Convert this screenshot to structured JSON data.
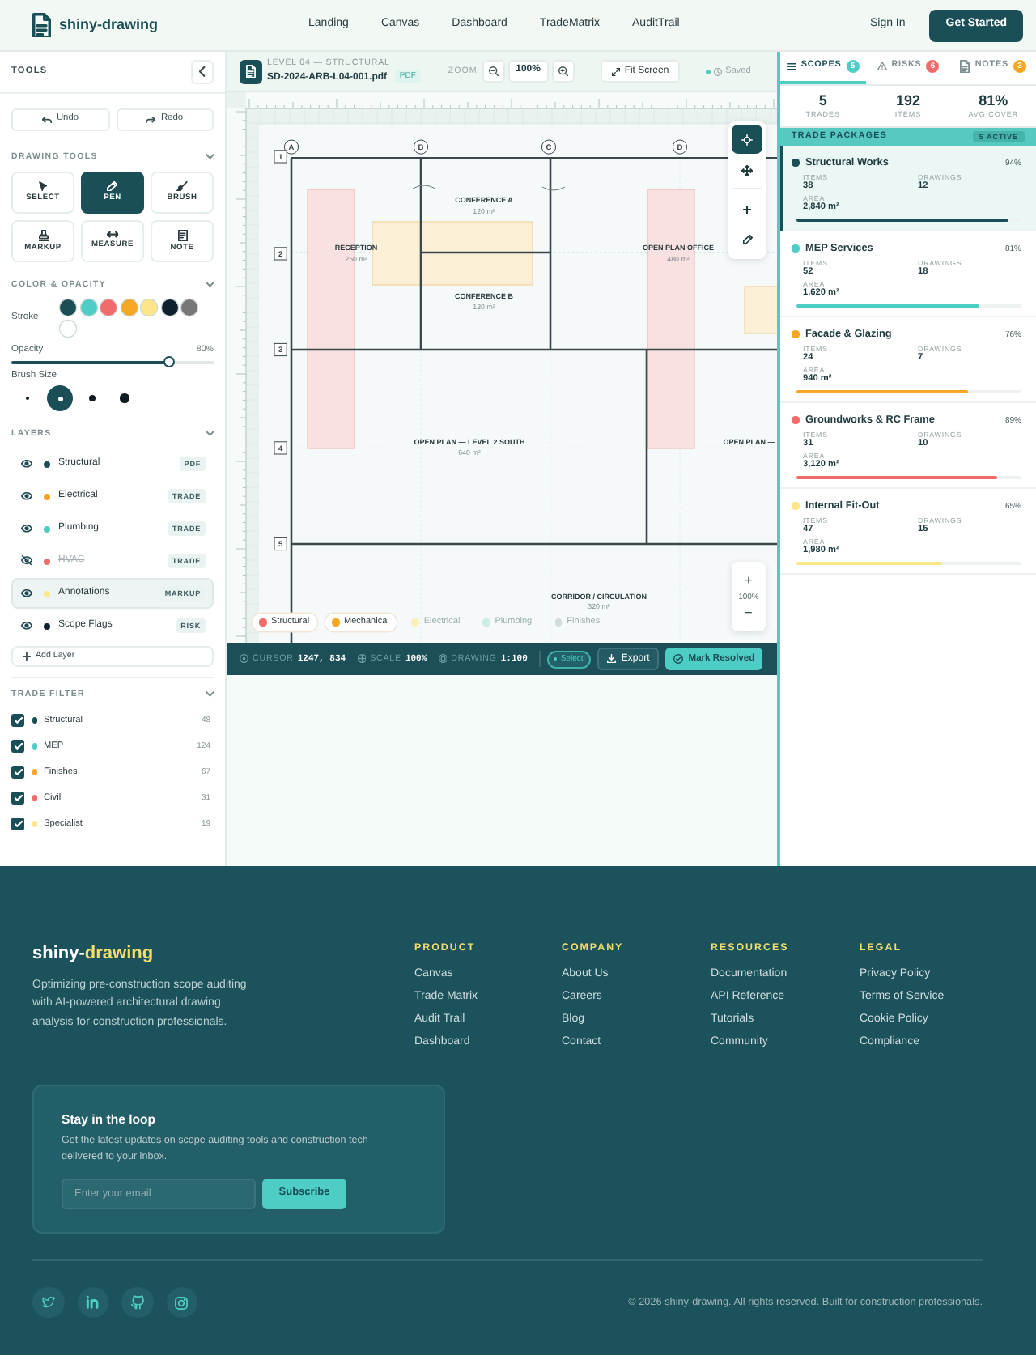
{
  "navbar": {
    "brand": "shiny-drawing",
    "links": [
      "Landing",
      "Canvas",
      "Dashboard",
      "TradeMatrix",
      "AuditTrail"
    ],
    "sign_in": "Sign In",
    "cta": "Get Started"
  },
  "sidebar": {
    "title": "TOOLS",
    "history": [
      {
        "kind": "undo",
        "label": "Undo"
      },
      {
        "kind": "redo",
        "label": "Redo"
      }
    ],
    "drawing_tools": {
      "title": "DRAWING TOOLS",
      "expanded": true,
      "tools": [
        {
          "kind": "select",
          "label": "SELECT",
          "selected": false
        },
        {
          "kind": "pen",
          "label": "PEN",
          "selected": true
        },
        {
          "kind": "brush",
          "label": "BRUSH",
          "selected": false
        },
        {
          "kind": "markup",
          "label": "MARKUP",
          "selected": false
        },
        {
          "kind": "measure",
          "label": "MEASURE",
          "selected": false
        },
        {
          "kind": "note",
          "label": "NOTE",
          "selected": false
        }
      ]
    },
    "color_opacity": {
      "title": "COLOR & OPACITY",
      "expanded": true,
      "stroke_label": "Stroke",
      "swatches": [
        {
          "color": "#1b4f57"
        },
        {
          "color": "#4ecdc4"
        },
        {
          "color": "#f26b6b"
        },
        {
          "color": "#f5a623"
        },
        {
          "color": "#fde68a"
        },
        {
          "color": "#0f1f2e"
        },
        {
          "color": "#777777"
        },
        {
          "color": "#ffffff"
        }
      ],
      "opacity": {
        "label": "Opacity",
        "reading": "80%",
        "level": 0.8
      },
      "brush_size": {
        "label": "Brush Size",
        "sizes": [
          {
            "kind": "xs",
            "selected": false
          },
          {
            "kind": "sm",
            "selected": true
          },
          {
            "kind": "md",
            "selected": false
          },
          {
            "kind": "lg",
            "selected": false
          }
        ]
      }
    },
    "layers": {
      "title": "LAYERS",
      "expanded": true,
      "items": [
        {
          "name": "Structural",
          "color": "#1b4f57",
          "visible": true,
          "selected": false,
          "tag": "PDF"
        },
        {
          "name": "Electrical",
          "color": "#f5a623",
          "visible": true,
          "selected": false,
          "tag": "TRADE"
        },
        {
          "name": "Plumbing",
          "color": "#4ecdc4",
          "visible": true,
          "selected": false,
          "tag": "TRADE"
        },
        {
          "name": "HVAC",
          "color": "#f26b6b",
          "visible": false,
          "selected": false,
          "tag": "TRADE"
        },
        {
          "name": "Annotations",
          "color": "#fde68a",
          "visible": true,
          "selected": true,
          "tag": "MARKUP"
        },
        {
          "name": "Scope Flags",
          "color": "#0f1f2e",
          "visible": true,
          "selected": false,
          "tag": "RISK"
        }
      ],
      "add_label": "Add Layer"
    },
    "trade_filter": {
      "title": "TRADE FILTER",
      "expanded": true,
      "items": [
        {
          "label": "Structural",
          "color": "#1b4f57",
          "checked": true,
          "count": "48"
        },
        {
          "label": "MEP",
          "color": "#4ecdc4",
          "checked": true,
          "count": "124"
        },
        {
          "label": "Finishes",
          "color": "#f5a623",
          "checked": true,
          "count": "67"
        },
        {
          "label": "Civil",
          "color": "#f26b6b",
          "checked": true,
          "count": "31"
        },
        {
          "label": "Specialist",
          "color": "#fde68a",
          "checked": true,
          "count": "19"
        }
      ]
    }
  },
  "canvas": {
    "sheet": {
      "subtitle": "LEVEL 04 — STRUCTURAL",
      "file": "SD-2024-ARB-L04-001.pdf",
      "format": "PDF"
    },
    "zoom": {
      "label": "ZOOM",
      "value": "100%"
    },
    "fit_label": "Fit Screen",
    "save_status": "Saved",
    "plan": {
      "columns": [
        "A",
        "B",
        "C",
        "D"
      ],
      "rows": [
        "1",
        "2",
        "3",
        "4",
        "5"
      ],
      "rooms": [
        {
          "name": "CONFERENCE A",
          "area": "120 m²"
        },
        {
          "name": "RECEPTION",
          "area": "250 m²"
        },
        {
          "name": "CONFERENCE B",
          "area": "120 m²"
        },
        {
          "name": "OPEN PLAN OFFICE",
          "area": "480 m²"
        },
        {
          "name": "OPEN PLAN — LEVEL 2 SOUTH",
          "area": "640 m²"
        },
        {
          "name": "OPEN PLAN —"
        },
        {
          "name": "CORRIDOR / CIRCULATION",
          "area": "320 m²"
        }
      ],
      "overlays": [
        {
          "kind": "structural"
        },
        {
          "kind": "structural"
        },
        {
          "kind": "mechanical"
        },
        {
          "kind": "mechanical"
        }
      ]
    },
    "palette_groups": [
      [
        {
          "kind": "crosshair",
          "selected": true
        },
        {
          "kind": "move",
          "selected": false
        }
      ],
      [
        {
          "kind": "target",
          "selected": false
        },
        {
          "kind": "pencil",
          "selected": false
        }
      ]
    ],
    "zoom_control": {
      "plus": "+",
      "reading": "100%",
      "minus": "−"
    },
    "legend": [
      {
        "label": "Structural",
        "color": "#f26b6b",
        "on": true
      },
      {
        "label": "Mechanical",
        "color": "#f5a623",
        "on": true
      },
      {
        "label": "Electrical",
        "color": "#fbefb8",
        "on": false
      },
      {
        "label": "Plumbing",
        "color": "#cdebe7",
        "on": false
      },
      {
        "label": "Finishes",
        "color": "#d3dcdc",
        "on": false
      }
    ],
    "status_bar": {
      "items": [
        {
          "kind": "cursor",
          "label": "CURSOR",
          "value": "1247, 834"
        },
        {
          "kind": "scale",
          "label": "SCALE",
          "value": "100%"
        },
        {
          "kind": "drawing",
          "label": "DRAWING",
          "value": "1:100"
        }
      ],
      "chip": "Selecti",
      "export": "Export",
      "resolve": "Mark Resolved"
    }
  },
  "panel": {
    "tabs": [
      {
        "kind": "list",
        "label": "SCOPES",
        "count": "5",
        "color": "#4ecdc4",
        "selected": true
      },
      {
        "kind": "warning",
        "label": "RISKS",
        "count": "6",
        "color": "#f26b6b",
        "selected": false
      },
      {
        "kind": "document",
        "label": "NOTES",
        "count": "3",
        "color": "#f5a623",
        "selected": false
      }
    ],
    "stats": [
      {
        "value": "5",
        "label": "TRADES"
      },
      {
        "value": "192",
        "label": "ITEMS"
      },
      {
        "value": "81%",
        "label": "AVG COVER"
      }
    ],
    "packages": {
      "title": "TRADE PACKAGES",
      "badge": "5 ACTIVE",
      "items": [
        {
          "name": "Structural Works",
          "color": "#1b4f57",
          "percent": "94%",
          "level": 0.94,
          "selected": true,
          "fields": [
            {
              "label": "ITEMS",
              "value": "38"
            },
            {
              "label": "DRAWINGS",
              "value": "12"
            },
            {
              "label": "AREA",
              "value": "2,840 m²"
            }
          ]
        },
        {
          "name": "MEP Services",
          "color": "#4ecdc4",
          "percent": "81%",
          "level": 0.81,
          "selected": false,
          "fields": [
            {
              "label": "ITEMS",
              "value": "52"
            },
            {
              "label": "DRAWINGS",
              "value": "18"
            },
            {
              "label": "AREA",
              "value": "1,620 m²"
            }
          ]
        },
        {
          "name": "Facade & Glazing",
          "color": "#f5a623",
          "percent": "76%",
          "level": 0.76,
          "selected": false,
          "fields": [
            {
              "label": "ITEMS",
              "value": "24"
            },
            {
              "label": "DRAWINGS",
              "value": "7"
            },
            {
              "label": "AREA",
              "value": "940 m²"
            }
          ]
        },
        {
          "name": "Groundworks & RC Frame",
          "color": "#f26b6b",
          "percent": "89%",
          "level": 0.89,
          "selected": false,
          "fields": [
            {
              "label": "ITEMS",
              "value": "31"
            },
            {
              "label": "DRAWINGS",
              "value": "10"
            },
            {
              "label": "AREA",
              "value": "3,120 m²"
            }
          ]
        },
        {
          "name": "Internal Fit-Out",
          "color": "#fde68a",
          "percent": "65%",
          "level": 0.65,
          "selected": false,
          "fields": [
            {
              "label": "ITEMS",
              "value": "47"
            },
            {
              "label": "DRAWINGS",
              "value": "15"
            },
            {
              "label": "AREA",
              "value": "1,980 m²"
            }
          ]
        }
      ]
    }
  },
  "footer": {
    "brand": {
      "lead": "shiny-",
      "accent": "drawing"
    },
    "tagline": "Optimizing pre-construction scope auditing with AI-powered architectural drawing analysis for construction professionals.",
    "columns": [
      {
        "title": "PRODUCT",
        "links": [
          "Canvas",
          "Trade Matrix",
          "Audit Trail",
          "Dashboard"
        ]
      },
      {
        "title": "COMPANY",
        "links": [
          "About Us",
          "Careers",
          "Blog",
          "Contact"
        ]
      },
      {
        "title": "RESOURCES",
        "links": [
          "Documentation",
          "API Reference",
          "Tutorials",
          "Community"
        ]
      },
      {
        "title": "LEGAL",
        "links": [
          "Privacy Policy",
          "Terms of Service",
          "Cookie Policy",
          "Compliance"
        ]
      }
    ],
    "newsletter": {
      "title": "Stay in the loop",
      "text": "Get the latest updates on scope auditing tools and construction tech delivered to your inbox.",
      "placeholder": "Enter your email",
      "button": "Subscribe"
    },
    "socials": [
      {
        "kind": "bird"
      },
      {
        "kind": "in"
      },
      {
        "kind": "cat"
      },
      {
        "kind": "camera"
      }
    ],
    "copyright": "© 2026 shiny-drawing. All rights reserved. Built for construction professionals."
  }
}
